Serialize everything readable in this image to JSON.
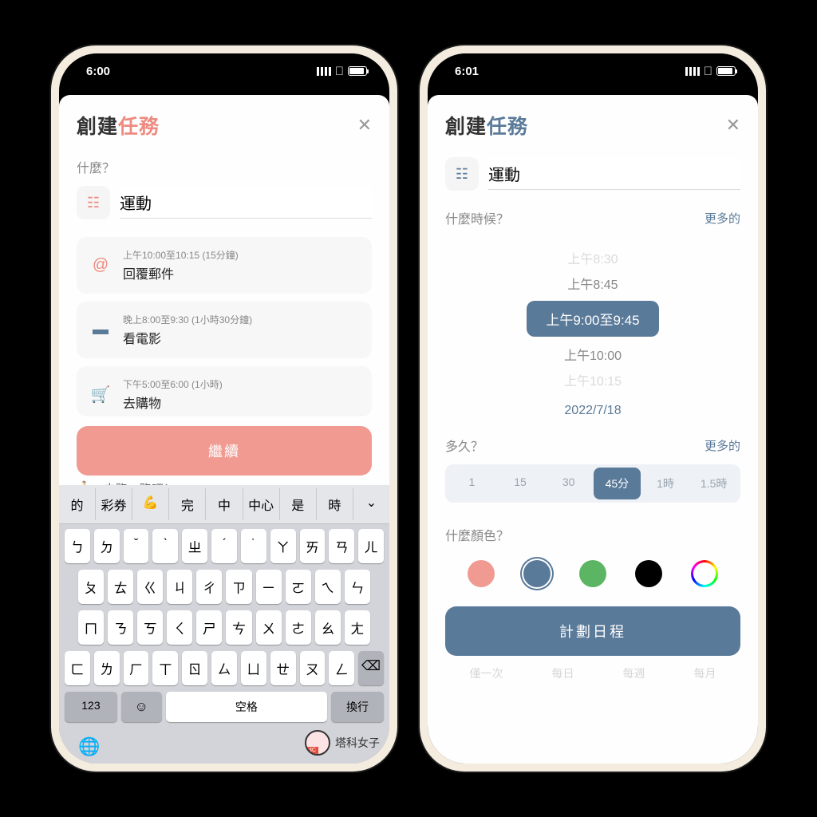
{
  "left": {
    "statusTime": "6:00",
    "title1": "創建",
    "title2": "任務",
    "whatLabel": "什麼？",
    "taskInput": "運動",
    "suggestions": [
      {
        "icon": "@",
        "iconColor": "#ee8a80",
        "time": "上午10:00至10:15 (15分鐘)",
        "title": "回覆郵件"
      },
      {
        "icon": "🖥",
        "iconColor": "#5a7a99",
        "time": "晚上8:00至9:30 (1小時30分鐘)",
        "title": "看電影"
      },
      {
        "icon": "🛒",
        "iconColor": "#ee8a80",
        "time": "下午5:00至6:00 (1小時)",
        "title": "去購物"
      }
    ],
    "continueLabel": "繼續",
    "hiddenSug": "去跑一跑吧！",
    "kbSuggestions": [
      "的",
      "彩券",
      "💪",
      "完",
      "中",
      "中心",
      "是",
      "時"
    ],
    "kbRows": [
      [
        "ㄅ",
        "ㄉ",
        "ˇ",
        "ˋ",
        "ㄓ",
        "ˊ",
        "˙",
        "ㄚ",
        "ㄞ",
        "ㄢ",
        "ㄦ"
      ],
      [
        "ㄆ",
        "ㄊ",
        "ㄍ",
        "ㄐ",
        "ㄔ",
        "ㄗ",
        "ㄧ",
        "ㄛ",
        "ㄟ",
        "ㄣ"
      ],
      [
        "ㄇ",
        "ㄋ",
        "ㄎ",
        "ㄑ",
        "ㄕ",
        "ㄘ",
        "ㄨ",
        "ㄜ",
        "ㄠ",
        "ㄤ"
      ],
      [
        "ㄈ",
        "ㄌ",
        "ㄏ",
        "ㄒ",
        "ㄖ",
        "ㄙ",
        "ㄩ",
        "ㄝ",
        "ㄡ",
        "ㄥ"
      ]
    ],
    "kb123": "123",
    "kbSpace": "空格",
    "kbReturn": "換行",
    "watermark": "塔科女子"
  },
  "right": {
    "statusTime": "6:01",
    "title1": "創建",
    "title2": "任務",
    "taskInput": "運動",
    "whenLabel": "什麼時候？",
    "moreLabel": "更多的",
    "timeOptions": {
      "above2": "上午8:30",
      "above1": "上午8:45",
      "selected": "上午9:00至9:45",
      "below1": "上午10:00",
      "below2": "上午10:15"
    },
    "date": "2022/7/18",
    "durationLabel": "多久？",
    "durations": [
      "1",
      "15",
      "30",
      "45分",
      "1時",
      "1.5時"
    ],
    "durationSelectedIndex": 3,
    "colorLabel": "什麼顏色？",
    "colors": [
      "#f09a92",
      "#5a7a99",
      "#5cb563",
      "#000000",
      "rainbow"
    ],
    "colorSelectedIndex": 1,
    "scheduleLabel": "計劃日程",
    "recurrence": [
      "僅一次",
      "每日",
      "每週",
      "每月"
    ]
  }
}
